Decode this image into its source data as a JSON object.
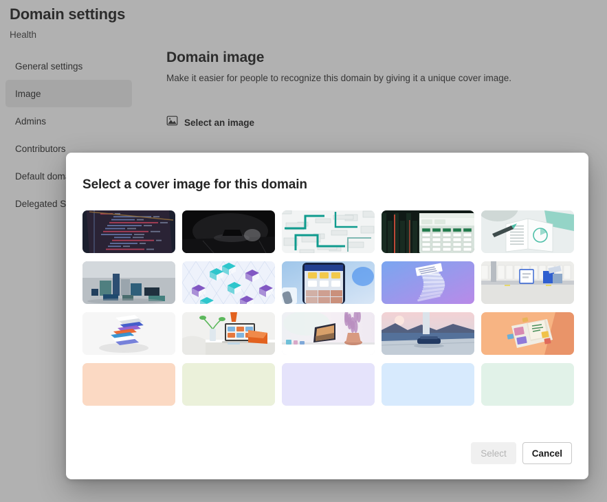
{
  "page": {
    "title": "Domain settings",
    "subtitle": "Health",
    "sidebar": {
      "items": [
        {
          "label": "General settings",
          "selected": false
        },
        {
          "label": "Image",
          "selected": true
        },
        {
          "label": "Admins",
          "selected": false
        },
        {
          "label": "Contributors",
          "selected": false
        },
        {
          "label": "Default doma",
          "selected": false
        },
        {
          "label": "Delegated Se",
          "selected": false
        }
      ]
    },
    "content": {
      "heading": "Domain image",
      "description": "Make it easier for people to recognize this domain by giving it a unique cover image.",
      "select_image_label": "Select an image",
      "select_image_icon": "image-icon"
    }
  },
  "dialog": {
    "title": "Select a cover image for this domain",
    "buttons": {
      "select": {
        "label": "Select",
        "disabled": true
      },
      "cancel": {
        "label": "Cancel",
        "disabled": false
      }
    },
    "thumbnails": [
      {
        "name": "code-editor-screen",
        "style": "photo",
        "colors": [
          "#1b1f2e",
          "#2a2335",
          "#8c6a3a",
          "#c8455e"
        ]
      },
      {
        "name": "dark-laptop-on-desk",
        "style": "photo",
        "colors": [
          "#0b0b0c",
          "#1c1c1e",
          "#3a3a3d",
          "#8a8a8e"
        ]
      },
      {
        "name": "teal-circuit-pattern",
        "style": "photo",
        "colors": [
          "#e6eaea",
          "#f2f4f4",
          "#0f9b8e",
          "#7fb8b2"
        ]
      },
      {
        "name": "city-lights-spreadsheet",
        "style": "photo",
        "colors": [
          "#101a16",
          "#1f3a2c",
          "#cf4b3a",
          "#d8e3dc"
        ]
      },
      {
        "name": "open-notebook-with-pen",
        "style": "photo",
        "colors": [
          "#e9eeee",
          "#ffffff",
          "#4fbfa8",
          "#bcc6c6"
        ]
      },
      {
        "name": "grey-blocks-3d",
        "style": "photo",
        "colors": [
          "#b9bfc4",
          "#d3d8dc",
          "#4f7f80",
          "#22405e"
        ]
      },
      {
        "name": "glass-cubes-pattern",
        "style": "photo",
        "colors": [
          "#dfe6f5",
          "#eef2fb",
          "#7b4fc0",
          "#23c3c9"
        ]
      },
      {
        "name": "phone-app-mockup",
        "style": "photo",
        "colors": [
          "#bfd8ef",
          "#1f3f9e",
          "#f2c94c",
          "#2f80ed"
        ]
      },
      {
        "name": "stacked-documents-spiral",
        "style": "photo",
        "colors": [
          "#7aa6f0",
          "#b98ae8",
          "#e9ecf7",
          "#5c49c8"
        ]
      },
      {
        "name": "office-shelf-render",
        "style": "photo",
        "colors": [
          "#e7e7e5",
          "#c9ccd0",
          "#2f5fd0",
          "#8fa9c9"
        ]
      },
      {
        "name": "floating-papers",
        "style": "photo",
        "colors": [
          "#ececec",
          "#f6f6f6",
          "#3b55c8",
          "#e8622c"
        ]
      },
      {
        "name": "desk-with-laptop",
        "style": "photo",
        "colors": [
          "#efefed",
          "#ffffff",
          "#e2621f",
          "#5cb85c"
        ]
      },
      {
        "name": "tablet-with-lavender",
        "style": "photo",
        "colors": [
          "#f1eef2",
          "#ffffff",
          "#b98ec0",
          "#2c2c3a"
        ]
      },
      {
        "name": "blue-lake-landscape",
        "style": "photo",
        "colors": [
          "#f0cfd0",
          "#7e9fc4",
          "#233a62",
          "#c8d3de"
        ]
      },
      {
        "name": "orange-desk-magazine",
        "style": "photo",
        "colors": [
          "#f4a46a",
          "#f7b483",
          "#e8e3d8",
          "#cf5a3a"
        ]
      },
      {
        "name": "solid-peach",
        "style": "solid",
        "colors": [
          "#fbd9c3"
        ]
      },
      {
        "name": "solid-light-green",
        "style": "solid",
        "colors": [
          "#ebf1da"
        ]
      },
      {
        "name": "solid-lavender",
        "style": "solid",
        "colors": [
          "#e5e3fb"
        ]
      },
      {
        "name": "solid-light-blue",
        "style": "solid",
        "colors": [
          "#d7eafd"
        ]
      },
      {
        "name": "solid-mint",
        "style": "solid",
        "colors": [
          "#e1f2e8"
        ]
      }
    ]
  }
}
